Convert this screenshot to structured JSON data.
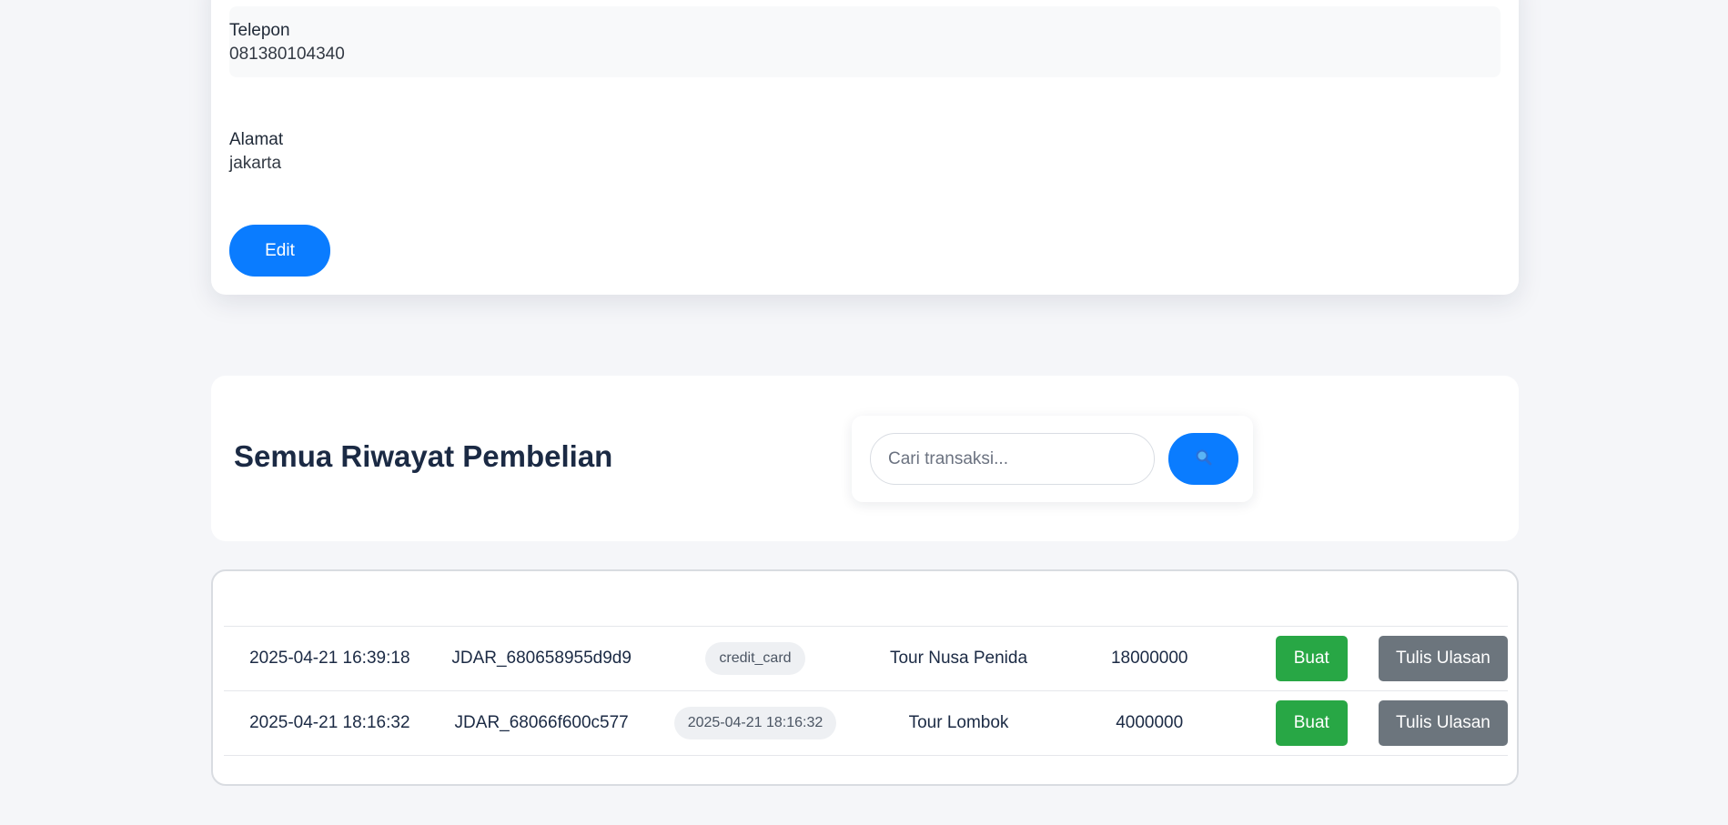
{
  "profile": {
    "fields": [
      {
        "label": "Telepon",
        "value": "081380104340"
      },
      {
        "label": "Alamat",
        "value": "jakarta"
      }
    ],
    "edit_label": "Edit"
  },
  "history": {
    "title": "Semua Riwayat Pembelian",
    "search": {
      "placeholder": "Cari transaksi...",
      "icon": "search-icon"
    }
  },
  "transactions": [
    {
      "date": "2025-04-21 16:39:18",
      "code": "JDAR_680658955d9d9",
      "payment": "credit_card",
      "package": "Tour Nusa Penida",
      "amount": "18000000",
      "action_primary": "Buat",
      "action_review": "Tulis Ulasan"
    },
    {
      "date": "2025-04-21 18:16:32",
      "code": "JDAR_68066f600c577",
      "payment": "2025-04-21 18:16:32",
      "package": "Tour Lombok",
      "amount": "4000000",
      "action_primary": "Buat",
      "action_review": "Tulis Ulasan"
    }
  ],
  "colors": {
    "primary": "#0a7cff",
    "success": "#28a745",
    "secondary": "#6c757d",
    "title": "#1b2a44",
    "background": "#f5f6f9"
  }
}
